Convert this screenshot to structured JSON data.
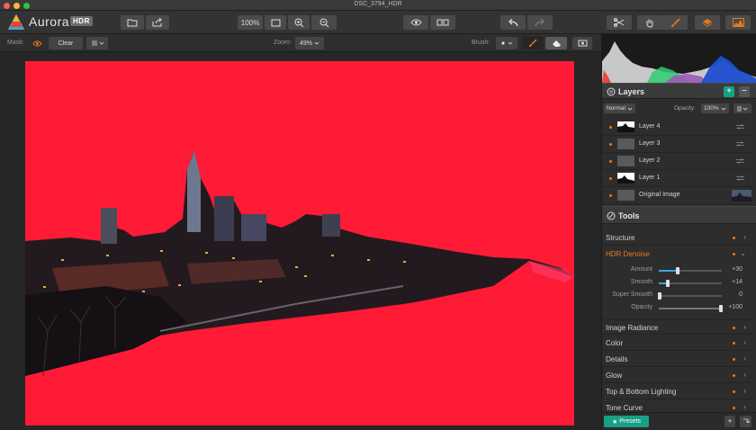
{
  "window": {
    "title": "DSC_3794_HDR"
  },
  "colors": {
    "accent": "#ff1a35",
    "highlight": "#e87a1e",
    "presets": "#17a086",
    "add_layer": "#17a086"
  },
  "toolbar": {
    "logo_text": "Aurora",
    "logo_badge": "HDR",
    "zoom_fit": "100%",
    "icons": [
      "open-icon",
      "share-icon",
      "fit-screen-icon",
      "zoom-in-icon",
      "zoom-out-icon",
      "preview-eye-icon",
      "compare-icon",
      "undo-icon",
      "redo-icon",
      "crop-icon",
      "hand-icon",
      "brush-icon",
      "layers-icon",
      "histogram-icon"
    ]
  },
  "options": {
    "mask_label": "Mask:",
    "clear_label": "Clear",
    "zoom_label": "Zoom:",
    "zoom_value": "49%",
    "brush_label": "Brush:"
  },
  "layers_panel": {
    "title": "Layers",
    "blend_mode": "Normal",
    "opacity_label": "Opacity:",
    "opacity_value": "100%",
    "layers": [
      {
        "name": "Layer 4"
      },
      {
        "name": "Layer 3"
      },
      {
        "name": "Layer 2"
      },
      {
        "name": "Layer 1"
      },
      {
        "name": "Original Image"
      }
    ]
  },
  "tools_panel": {
    "title": "Tools",
    "sections": [
      {
        "name": "Structure"
      },
      {
        "name": "HDR Denoise"
      },
      {
        "name": "Image Radiance"
      },
      {
        "name": "Color"
      },
      {
        "name": "Details"
      },
      {
        "name": "Glow"
      },
      {
        "name": "Top & Bottom Lighting"
      },
      {
        "name": "Tone Curve"
      }
    ],
    "denoise_sliders": [
      {
        "label": "Amount",
        "value": "+30",
        "fraction": 0.3
      },
      {
        "label": "Smooth",
        "value": "+14",
        "fraction": 0.14
      },
      {
        "label": "Super Smooth",
        "value": "0",
        "fraction": 0.0
      },
      {
        "label": "Opacity",
        "value": "+100",
        "fraction": 1.0
      }
    ]
  },
  "footer": {
    "presets_label": "Presets"
  }
}
